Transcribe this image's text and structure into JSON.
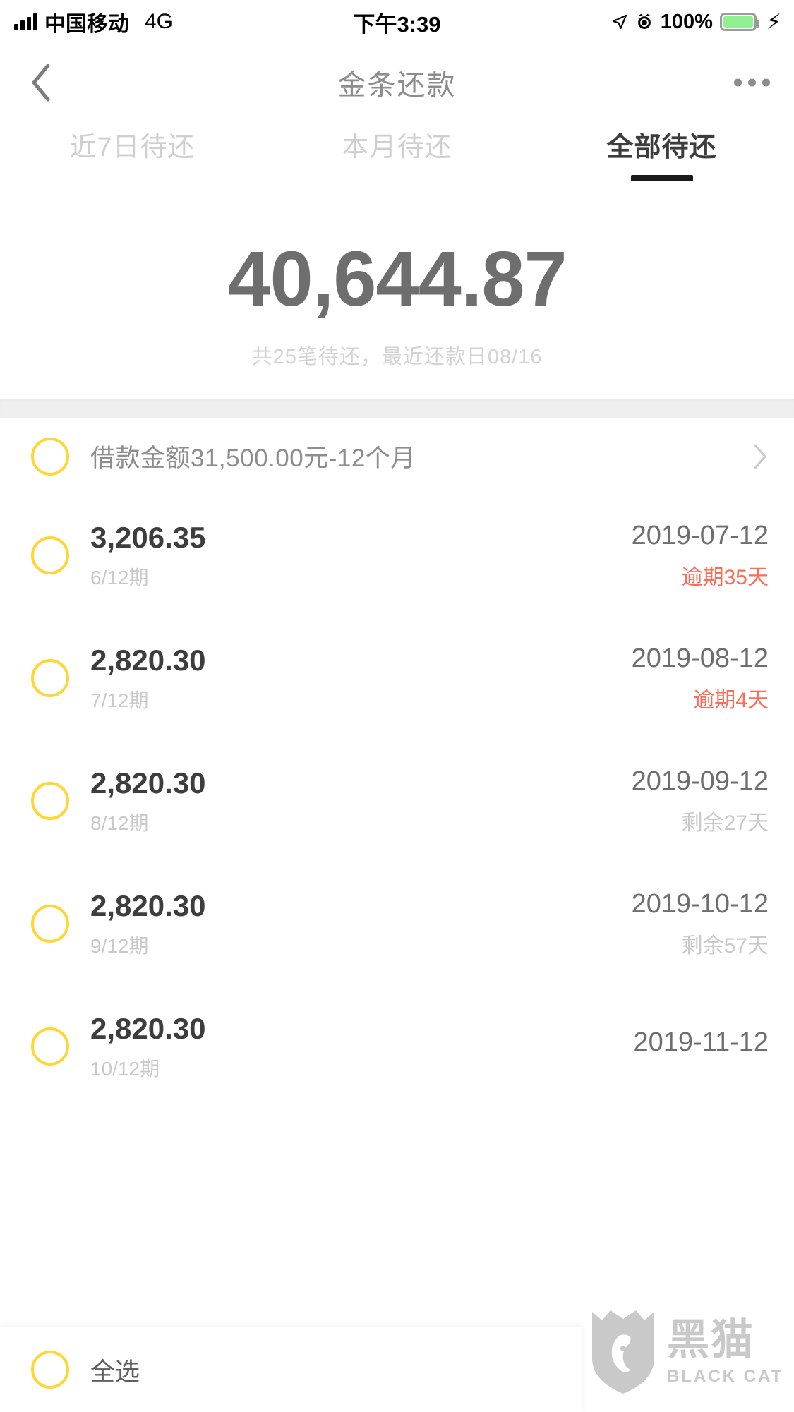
{
  "status_bar": {
    "carrier": "中国移动",
    "network": "4G",
    "time": "下午3:39",
    "battery_percent": "100%",
    "signal_icon": "signal-bars-icon",
    "location_icon": "location-arrow-icon",
    "alarm_icon": "alarm-clock-icon",
    "battery_icon": "battery-icon",
    "charging_icon": "lightning-bolt-icon"
  },
  "nav": {
    "title": "金条还款",
    "back_icon": "chevron-left-icon",
    "more_icon": "more-horizontal-icon"
  },
  "tabs": [
    {
      "label": "近7日待还",
      "active": false
    },
    {
      "label": "本月待还",
      "active": false
    },
    {
      "label": "全部待还",
      "active": true
    }
  ],
  "summary": {
    "amount": "40,644.87",
    "subtitle": "共25笔待还，最近还款日08/16"
  },
  "loan_header": {
    "text": "借款金额31,500.00元-12个月",
    "chevron_icon": "chevron-right-icon",
    "checkbox_icon": "circle-checkbox-icon"
  },
  "installments": [
    {
      "amount": "3,206.35",
      "period": "6/12期",
      "date": "2019-07-12",
      "status": "逾期35天",
      "status_type": "overdue"
    },
    {
      "amount": "2,820.30",
      "period": "7/12期",
      "date": "2019-08-12",
      "status": "逾期4天",
      "status_type": "overdue"
    },
    {
      "amount": "2,820.30",
      "period": "8/12期",
      "date": "2019-09-12",
      "status": "剩余27天",
      "status_type": "remain"
    },
    {
      "amount": "2,820.30",
      "period": "9/12期",
      "date": "2019-10-12",
      "status": "剩余57天",
      "status_type": "remain"
    },
    {
      "amount": "2,820.30",
      "period": "10/12期",
      "date": "2019-11-12",
      "status": "",
      "status_type": "remain"
    }
  ],
  "bottom_bar": {
    "select_all_label": "全选",
    "checkbox_icon": "circle-checkbox-icon"
  },
  "watermark": {
    "cn": "黑猫",
    "en": "BLACK CAT",
    "logo_icon": "black-cat-shield-icon"
  },
  "colors": {
    "accent_yellow": "#ffd633",
    "overdue_red": "#ff6b55",
    "text_dark": "#3d3d3d",
    "text_mid": "#6e6e6e",
    "text_light": "#c9c9c9",
    "band_gray": "#efefef"
  }
}
